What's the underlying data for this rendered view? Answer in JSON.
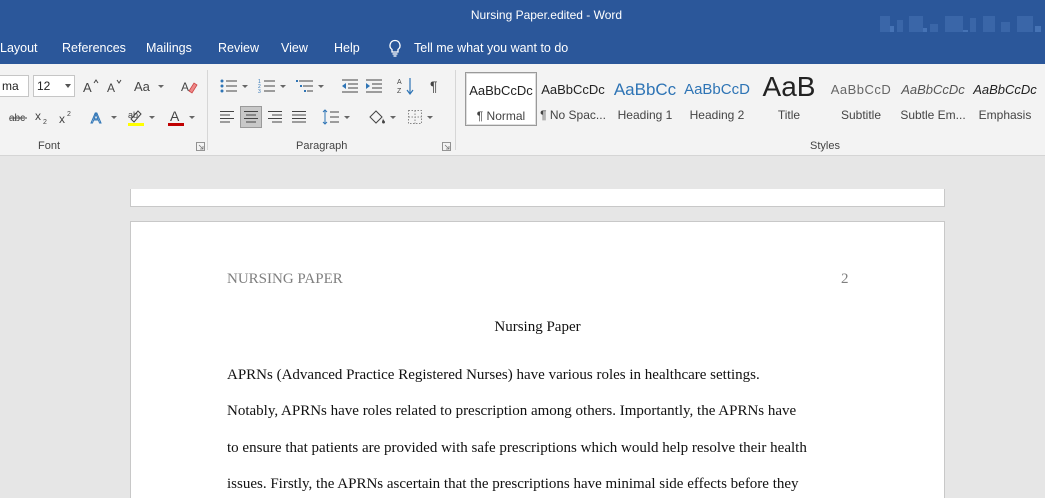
{
  "window": {
    "title": "Nursing Paper.edited  -  Word"
  },
  "tabs": [
    "Layout",
    "References",
    "Mailings",
    "Review",
    "View",
    "Help"
  ],
  "tell_me": "Tell me what you want to do",
  "font": {
    "family_value": "ma",
    "size_value": "12",
    "group_label": "Font"
  },
  "paragraph": {
    "group_label": "Paragraph"
  },
  "styles": {
    "group_label": "Styles",
    "items": [
      {
        "sample": "AaBbCcDc",
        "name": "¶ Normal"
      },
      {
        "sample": "AaBbCcDc",
        "name": "¶ No Spac..."
      },
      {
        "sample": "AaBbCc",
        "name": "Heading 1"
      },
      {
        "sample": "AaBbCcD",
        "name": "Heading 2"
      },
      {
        "sample": "AaB",
        "name": "Title"
      },
      {
        "sample": "AaBbCcD",
        "name": "Subtitle"
      },
      {
        "sample": "AaBbCcDc",
        "name": "Subtle Em..."
      },
      {
        "sample": "AaBbCcDc",
        "name": "Emphasis"
      }
    ]
  },
  "document": {
    "running_head": "NURSING PAPER",
    "page_number": "2",
    "title": "Nursing Paper",
    "lines": [
      "APRNs (Advanced Practice Registered Nurses) have various roles in healthcare settings.",
      "Notably, APRNs have roles related to prescription among others. Importantly, the APRNs have",
      "to ensure that patients are provided with safe prescriptions which would help resolve their health",
      "issues. Firstly, the APRNs ascertain that the prescriptions have minimal side effects before they"
    ]
  },
  "colors": {
    "ribbon_blue": "#2b579a",
    "heading_blue": "#2e74b5",
    "font_color_red": "#c00000",
    "highlight_yellow": "#ffff00"
  }
}
